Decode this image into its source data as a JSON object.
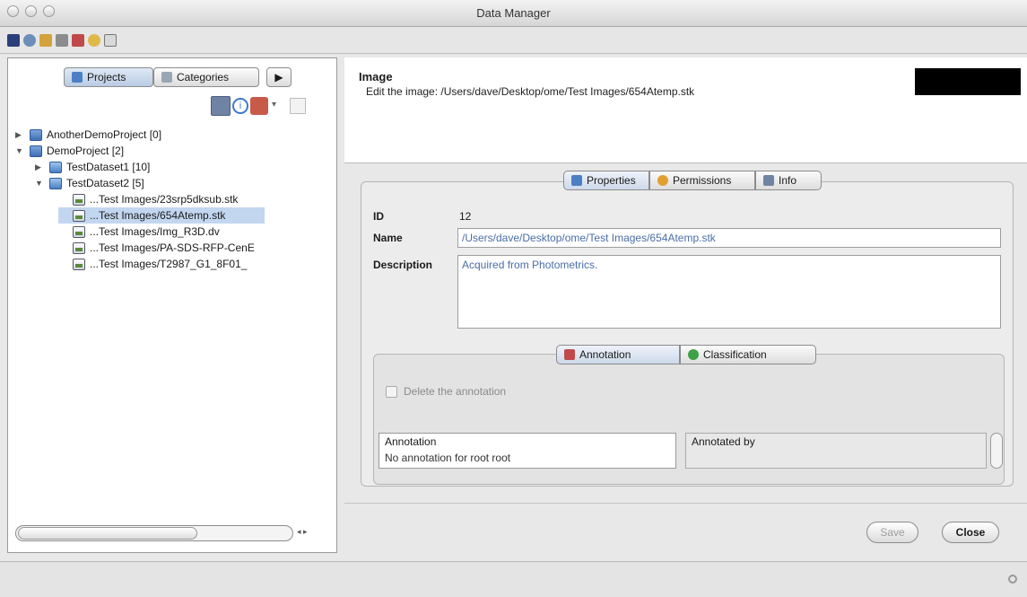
{
  "window": {
    "title": "Data Manager"
  },
  "toolbar": {
    "icons": [
      "data-manager-icon",
      "search-icon",
      "hierarchy-icon",
      "grid-icon",
      "annotation-icon",
      "classify-icon",
      "dataset-icon"
    ]
  },
  "left": {
    "tabs": {
      "projects": "Projects",
      "categories": "Categories"
    },
    "tree": [
      {
        "label": "AnotherDemoProject [0]",
        "level": 0,
        "expanded": false,
        "type": "project"
      },
      {
        "label": "DemoProject [2]",
        "level": 0,
        "expanded": true,
        "type": "project"
      },
      {
        "label": "TestDataset1 [10]",
        "level": 1,
        "expanded": false,
        "type": "dataset"
      },
      {
        "label": "TestDataset2 [5]",
        "level": 1,
        "expanded": true,
        "type": "dataset"
      },
      {
        "label": "...Test Images/23srp5dksub.stk",
        "level": 2,
        "type": "image"
      },
      {
        "label": "...Test Images/654Atemp.stk",
        "level": 2,
        "type": "image",
        "selected": true
      },
      {
        "label": "...Test Images/Img_R3D.dv",
        "level": 2,
        "type": "image"
      },
      {
        "label": "...Test Images/PA-SDS-RFP-CenE",
        "level": 2,
        "type": "image"
      },
      {
        "label": "...Test Images/T2987_G1_8F01_",
        "level": 2,
        "type": "image"
      }
    ]
  },
  "header": {
    "title": "Image",
    "subtitle": "Edit the image: /Users/dave/Desktop/ome/Test Images/654Atemp.stk"
  },
  "tabs": {
    "properties": "Properties",
    "permissions": "Permissions",
    "info": "Info"
  },
  "form": {
    "id_label": "ID",
    "id_value": "12",
    "name_label": "Name",
    "name_value": "/Users/dave/Desktop/ome/Test Images/654Atemp.stk",
    "description_label": "Description",
    "description_value": "Acquired from Photometrics."
  },
  "annotation": {
    "tabs": {
      "annotation": "Annotation",
      "classification": "Classification"
    },
    "delete_label": "Delete the annotation",
    "annotation_legend": "Annotation",
    "annotation_text": "No annotation for root root",
    "annotated_by_legend": "Annotated by"
  },
  "buttons": {
    "save": "Save",
    "close": "Close"
  },
  "colors": {
    "selection": "#c3d6f0",
    "value_text": "#4a6ea8"
  }
}
